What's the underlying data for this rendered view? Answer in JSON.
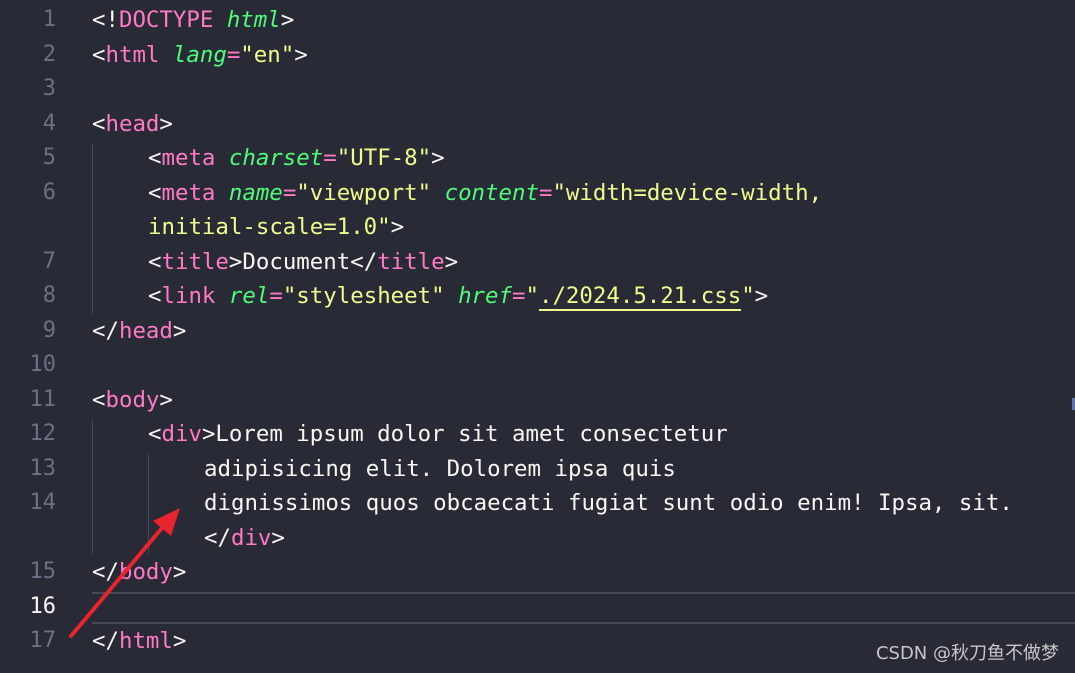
{
  "line_numbers": [
    "1",
    "2",
    "3",
    "4",
    "5",
    "6",
    "7",
    "8",
    "9",
    "10",
    "11",
    "12",
    "13",
    "14",
    "15",
    "16",
    "17"
  ],
  "active_line": "16",
  "code": {
    "l1": {
      "p1": "<!",
      "tag": "DOCTYPE",
      "sp": " ",
      "attr": "html",
      "p2": ">"
    },
    "l2": {
      "p1": "<",
      "tag": "html",
      "sp": " ",
      "attr": "lang",
      "eq": "=",
      "val": "\"en\"",
      "p2": ">"
    },
    "l4": {
      "p1": "<",
      "tag": "head",
      "p2": ">"
    },
    "l5": {
      "p1": "<",
      "tag": "meta",
      "sp": " ",
      "attr": "charset",
      "eq": "=",
      "val": "\"UTF-8\"",
      "p2": ">"
    },
    "l6": {
      "p1": "<",
      "tag": "meta",
      "sp": " ",
      "attr1": "name",
      "eq1": "=",
      "val1": "\"viewport\"",
      "sp2": " ",
      "attr2": "content",
      "eq2": "=",
      "val2": "\"width=device-width,"
    },
    "l6b": {
      "val": "initial-scale=1.0\"",
      "p2": ">"
    },
    "l7": {
      "p1": "<",
      "tag": "title",
      "p2": ">",
      "text": "Document",
      "p3": "</",
      "tag2": "title",
      "p4": ">"
    },
    "l8": {
      "p1": "<",
      "tag": "link",
      "sp": " ",
      "attr1": "rel",
      "eq1": "=",
      "val1": "\"stylesheet\"",
      "sp2": " ",
      "attr2": "href",
      "eq2": "=",
      "q1": "\"",
      "href": "./2024.5.21.css",
      "q2": "\"",
      "p2": ">"
    },
    "l9": {
      "p1": "</",
      "tag": "head",
      "p2": ">"
    },
    "l11": {
      "p1": "<",
      "tag": "body",
      "p2": ">"
    },
    "l12": {
      "p1": "<",
      "tag": "div",
      "p2": ">",
      "text": "Lorem ipsum dolor sit amet consectetur"
    },
    "l13": {
      "text": "adipisicing elit. Dolorem ipsa quis"
    },
    "l14": {
      "text": "dignissimos quos obcaecati fugiat sunt odio enim! Ipsa, sit."
    },
    "l14b": {
      "p1": "</",
      "tag": "div",
      "p2": ">"
    },
    "l15": {
      "p1": "</",
      "tag": "body",
      "p2": ">"
    },
    "l17": {
      "p1": "</",
      "tag": "html",
      "p2": ">"
    }
  },
  "watermark": "CSDN @秋刀鱼不做梦",
  "colors": {
    "background": "#282a36",
    "tag": "#ff79c6",
    "attribute": "#50fa7b",
    "string": "#f1fa8c",
    "arrow": "#e8242c"
  },
  "annotation": {
    "icon": "red-arrow-icon"
  }
}
